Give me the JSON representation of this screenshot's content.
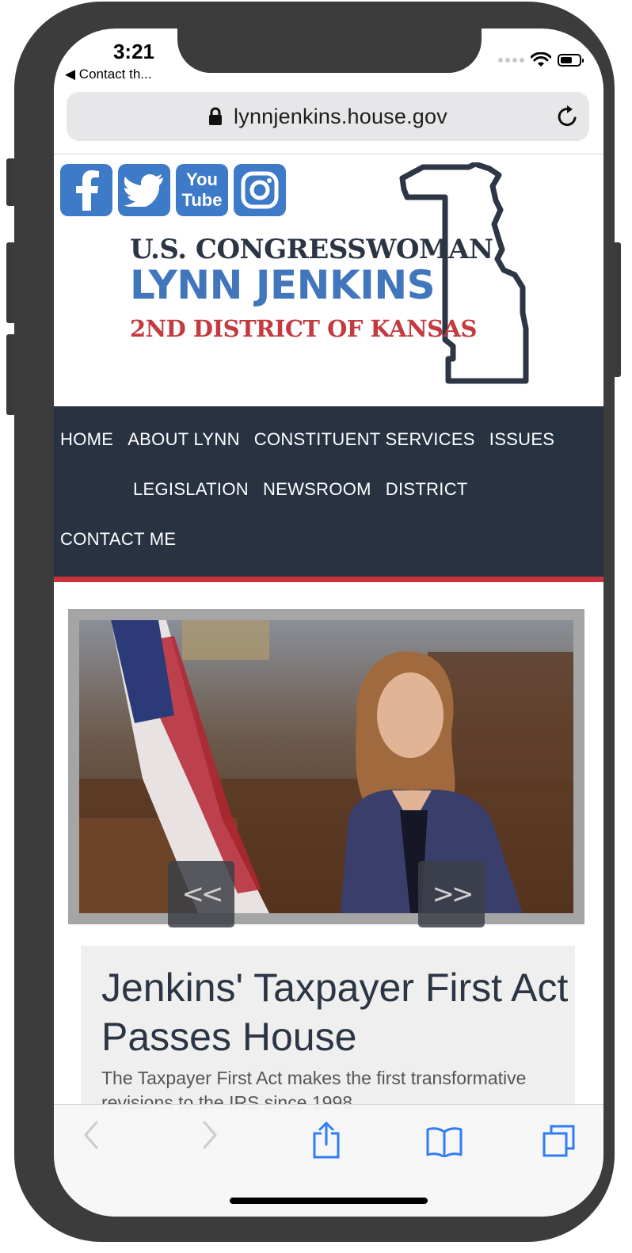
{
  "status_bar": {
    "time": "3:21",
    "back_label": "◀ Contact th..."
  },
  "browser": {
    "url": "lynnjenkins.house.gov",
    "lock_icon": "lock-icon",
    "reload_icon": "reload-icon"
  },
  "header": {
    "social_icons": [
      "facebook-icon",
      "twitter-icon",
      "youtube-icon",
      "instagram-icon"
    ],
    "youtube_text": [
      "You",
      "Tube"
    ],
    "logo_line1": "U.S. CONGRESSWOMAN",
    "logo_line2": "LYNN JENKINS",
    "logo_line3": "2ND DISTRICT OF KANSAS",
    "colors": {
      "social": "#3d7ac8",
      "line1": "#2b3544",
      "line2": "#4176bd",
      "line3": "#c33a3f"
    }
  },
  "nav": {
    "items": [
      "HOME",
      "ABOUT LYNN",
      "CONSTITUENT SERVICES",
      "ISSUES",
      "LEGISLATION",
      "NEWSROOM",
      "DISTRICT",
      "CONTACT ME"
    ],
    "colors": {
      "background": "#283241",
      "accent": "#c8333a"
    }
  },
  "slider": {
    "prev_label": "<<",
    "next_label": ">>"
  },
  "article": {
    "title": "Jenkins' Taxpayer First Act Passes House",
    "excerpt": "The Taxpayer First Act makes the first transformative revisions to the IRS since 1998"
  },
  "toolbar": {
    "icons": [
      "back-icon",
      "forward-icon",
      "share-icon",
      "bookmarks-icon",
      "tabs-icon"
    ]
  }
}
